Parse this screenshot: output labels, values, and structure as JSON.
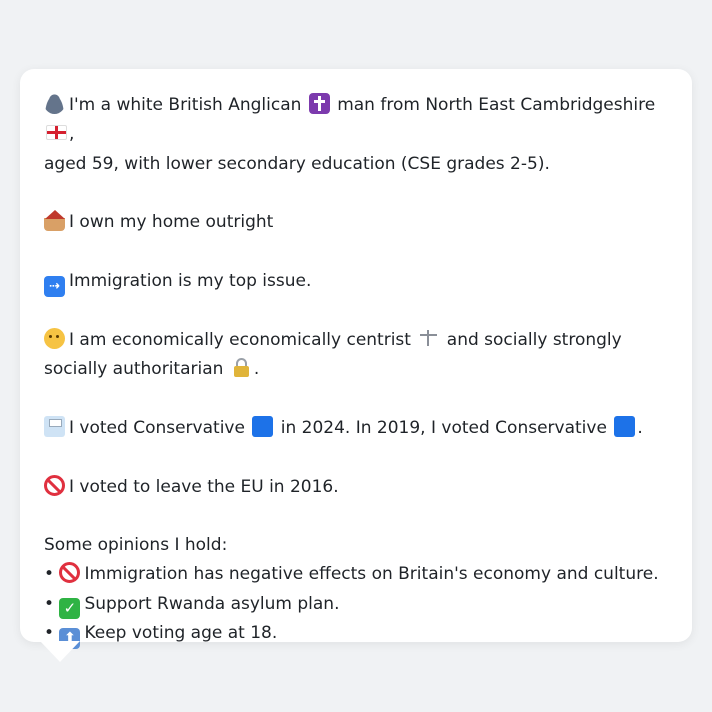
{
  "profile": {
    "intro": {
      "line1_a": "I'm a white British Anglican",
      "line1_b": "man from North East Cambridgeshire",
      "line1_c": ",",
      "line2": "aged 59, with lower secondary education (CSE grades 2-5)."
    },
    "home": "I own my home outright",
    "top_issue": "Immigration is my top issue.",
    "stance": {
      "a": "I am economically economically centrist",
      "b": "and socially strongly socially",
      "c": "authoritarian",
      "d": "."
    },
    "votes": {
      "a": "I voted Conservative",
      "b": "in 2024. In 2019, I voted Conservative",
      "c": "."
    },
    "eu": "I voted to leave the EU in 2016.",
    "opinions_header": "Some opinions I hold:",
    "opinions": [
      {
        "bullet": "•",
        "icon": "no-entry-icon",
        "text": "Immigration has negative effects on Britain's economy and culture."
      },
      {
        "bullet": "•",
        "icon": "check-mark-icon",
        "text": "Support Rwanda asylum plan."
      },
      {
        "bullet": "•",
        "icon": "up-arrow-icon",
        "text": "Keep voting age at 18."
      }
    ]
  },
  "icons": {
    "immigration_glyph": "⇢",
    "check_glyph": "✓",
    "up_glyph": "⬆"
  },
  "colors": {
    "conservative_blue": "#1d72e8",
    "background": "#f0f2f4",
    "bubble": "#ffffff"
  }
}
